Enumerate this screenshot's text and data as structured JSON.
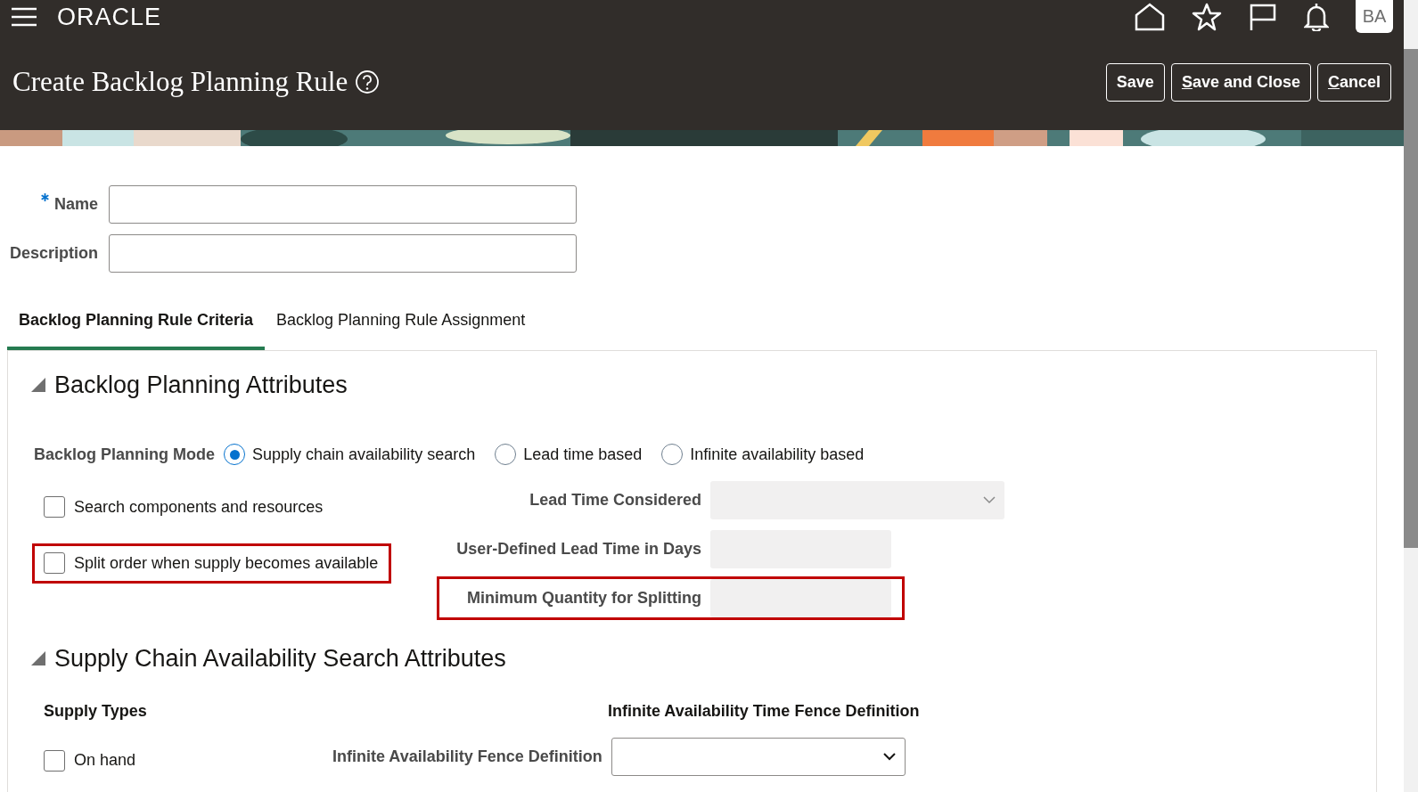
{
  "header": {
    "logo": "ORACLE",
    "avatar": "BA",
    "title": "Create Backlog Planning Rule",
    "buttons": [
      {
        "label": "Save",
        "underline_first": false
      },
      {
        "label": "Save and Close",
        "underline_first": true
      },
      {
        "label": "Cancel",
        "underline_first": true
      }
    ]
  },
  "form": {
    "fields": [
      {
        "label": "Name",
        "required": true
      },
      {
        "label": "Description",
        "required": false
      }
    ]
  },
  "tabs": [
    {
      "label": "Backlog Planning Rule Criteria",
      "selected": true
    },
    {
      "label": "Backlog Planning Rule Assignment",
      "selected": false
    }
  ],
  "backlog_planning_attributes": {
    "title": "Backlog Planning Attributes",
    "expanded": true,
    "mode_label": "Backlog Planning Mode",
    "modes": [
      {
        "label": "Supply chain availability search",
        "selected": true
      },
      {
        "label": "Lead time based",
        "selected": false
      },
      {
        "label": "Infinite availability based",
        "selected": false
      }
    ],
    "checkboxes": [
      {
        "label": "Search components and resources",
        "checked": false,
        "highlighted": false
      },
      {
        "label": "Split order when supply becomes available",
        "checked": false,
        "highlighted": true
      }
    ],
    "fields": [
      {
        "label": "Lead Time Considered",
        "kind": "select",
        "highlighted": false
      },
      {
        "label": "User-Defined Lead Time in Days",
        "kind": "text",
        "highlighted": false
      },
      {
        "label": "Minimum Quantity for Splitting",
        "kind": "text",
        "highlighted": true
      }
    ]
  },
  "supply_chain_section": {
    "title": "Supply Chain Availability Search Attributes",
    "expanded": true,
    "supply_types_heading": "Supply Types",
    "supply_types": [
      {
        "label": "On hand",
        "checked": false
      }
    ],
    "fence_heading": "Infinite Availability Time Fence Definition",
    "fence_field": {
      "label": "Infinite Availability Fence Definition"
    }
  }
}
